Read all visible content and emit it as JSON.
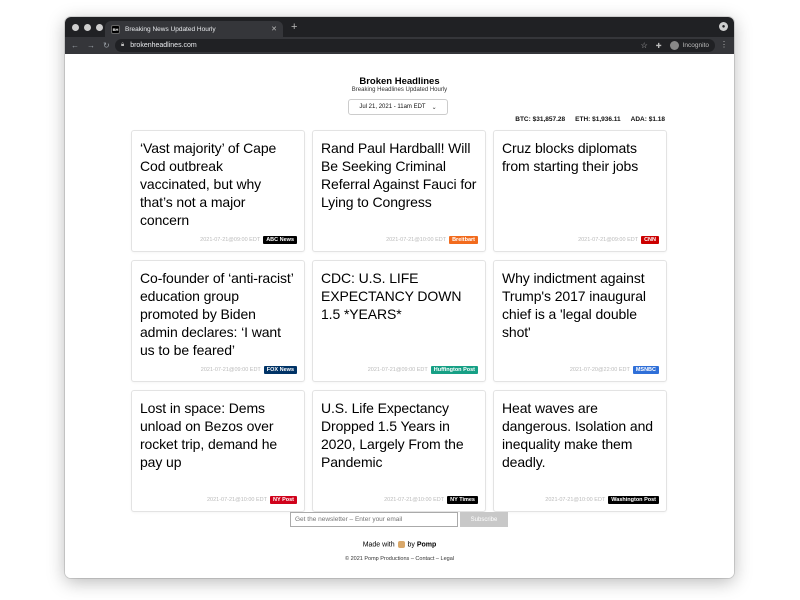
{
  "browser": {
    "tab_title": "Breaking News Updated Hourly",
    "favicon_text": "BH",
    "url": "brokenheadlines.com",
    "incognito_label": "Incognito"
  },
  "site": {
    "title": "Broken Headlines",
    "subtitle": "Breaking Headlines Updated Hourly",
    "date_selected": "Jul 21, 2021 - 11am EDT"
  },
  "crypto": [
    {
      "label": "BTC: $31,857.28"
    },
    {
      "label": "ETH: $1,936.11"
    },
    {
      "label": "ADA: $1.18"
    }
  ],
  "cards": [
    {
      "headline": "‘Vast majority’ of Cape Cod outbreak vaccinated, but why that’s not a major concern",
      "timestamp": "2021-07-21@09:00 EDT",
      "source": "ABC News",
      "color": "#000000"
    },
    {
      "headline": "Rand Paul Hardball! Will Be Seeking Criminal Referral Against Fauci for Lying to Congress",
      "timestamp": "2021-07-21@10:00 EDT",
      "source": "Breitbart",
      "color": "#f26b1d"
    },
    {
      "headline": "Cruz blocks diplomats from starting their jobs",
      "timestamp": "2021-07-21@09:00 EDT",
      "source": "CNN",
      "color": "#cc0000"
    },
    {
      "headline": "Co-founder of ‘anti-racist’ education group promoted by Biden admin declares: ‘I want us to be feared’",
      "timestamp": "2021-07-21@09:00 EDT",
      "source": "FOX News",
      "color": "#003366"
    },
    {
      "headline": "CDC: U.S. LIFE EXPECTANCY DOWN 1.5 *YEARS*",
      "timestamp": "2021-07-21@09:00 EDT",
      "source": "Huffington Post",
      "color": "#16a085"
    },
    {
      "headline": "Why indictment against Trump's 2017 inaugural chief is a 'legal double shot'",
      "timestamp": "2021-07-20@22:00 EDT",
      "source": "MSNBC",
      "color": "#2f6fd8"
    },
    {
      "headline": "Lost in space: Dems unload on Bezos over rocket trip, demand he pay up",
      "timestamp": "2021-07-21@10:00 EDT",
      "source": "NY Post",
      "color": "#d0021b"
    },
    {
      "headline": "U.S. Life Expectancy Dropped 1.5 Years in 2020, Largely From the Pandemic",
      "timestamp": "2021-07-21@10:00 EDT",
      "source": "NY Times",
      "color": "#000000"
    },
    {
      "headline": "Heat waves are dangerous. Isolation and inequality make them deadly.",
      "timestamp": "2021-07-21@10:00 EDT",
      "source": "Washington Post",
      "color": "#000000"
    }
  ],
  "newsletter": {
    "placeholder": "Get the newsletter – Enter your email",
    "button": "Subscribe"
  },
  "footer": {
    "made_prefix": "Made with",
    "made_suffix": "by",
    "made_brand": "Pomp",
    "copyright": "© 2021 Pomp Productions",
    "contact": "Contact",
    "legal": "Legal",
    "separator": "–"
  }
}
